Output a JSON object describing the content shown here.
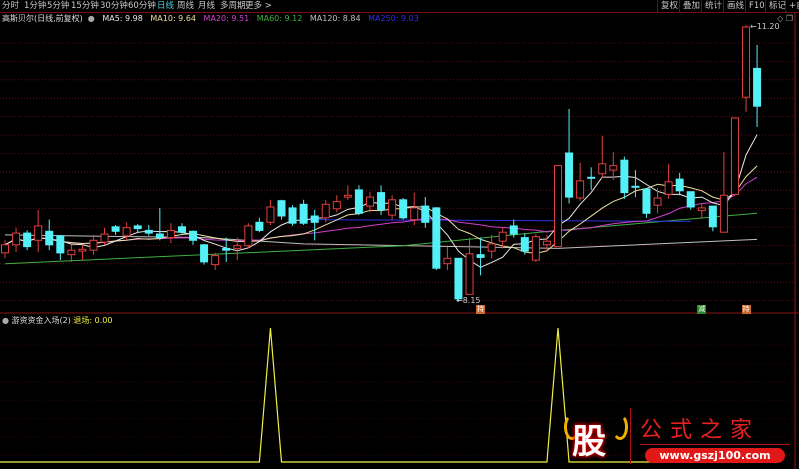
{
  "toolbar": {
    "tabs": [
      "分时",
      "1分钟",
      "5分钟",
      "15分钟",
      "30分钟",
      "60分钟",
      "日线",
      "周线",
      "月线",
      "多周期",
      "更多 >"
    ],
    "active_tab": "日线",
    "right_buttons": [
      "复权",
      "叠加",
      "统计",
      "画线",
      "F10",
      "标记",
      "+自"
    ]
  },
  "info": {
    "title": "高斯贝尔(日线,前复权)",
    "ma5": "MA5: 9.98",
    "ma10": "MA10: 9.64",
    "ma20": "MA20: 9.51",
    "ma60": "MA60: 9.12",
    "ma120": "MA120: 8.84",
    "ma250": "MA250: 9.03"
  },
  "corner_icons": {
    "diamond": "◇",
    "window": "❐"
  },
  "colors": {
    "up": "#e04040",
    "down": "#54f0f8",
    "ma5": "#e8e8e8",
    "ma10": "#e8e0a0",
    "ma20": "#d040d0",
    "ma60": "#40b040",
    "ma120": "#c0c0c0",
    "ma250": "#3030e0",
    "indicator": "#f0f040",
    "grid": "#7a1010"
  },
  "annotations": {
    "high": "11.20",
    "low": "8.15"
  },
  "markers": [
    {
      "text": "持",
      "color": "#c86a30",
      "index": 43
    },
    {
      "text": "减",
      "color": "#2a8a2a",
      "index": 63
    },
    {
      "text": "持",
      "color": "#c86a30",
      "index": 67
    }
  ],
  "indicator": {
    "name": "游资资金入场(2)",
    "value": "退场: 0.00"
  },
  "watermark": {
    "logo": "股",
    "title": "公式之家",
    "url": "www.gszj100.com"
  },
  "chart_data": {
    "type": "candlestick",
    "ylim": [
      8.0,
      11.5
    ],
    "candles_ohlc": [
      [
        8.69,
        8.78,
        8.83,
        8.63
      ],
      [
        8.78,
        8.91,
        8.97,
        8.7
      ],
      [
        8.91,
        8.76,
        8.94,
        8.72
      ],
      [
        8.83,
        8.99,
        9.17,
        8.7
      ],
      [
        8.93,
        8.78,
        9.06,
        8.72
      ],
      [
        8.88,
        8.69,
        8.89,
        8.61
      ],
      [
        8.67,
        8.72,
        8.78,
        8.59
      ],
      [
        8.71,
        8.73,
        8.78,
        8.61
      ],
      [
        8.72,
        8.83,
        8.89,
        8.67
      ],
      [
        8.81,
        8.9,
        8.97,
        8.78
      ],
      [
        8.98,
        8.93,
        9.0,
        8.89
      ],
      [
        8.88,
        8.97,
        9.03,
        8.83
      ],
      [
        8.99,
        8.96,
        9.01,
        8.92
      ],
      [
        8.94,
        8.91,
        9.0,
        8.88
      ],
      [
        8.9,
        8.86,
        9.19,
        8.83
      ],
      [
        8.86,
        8.94,
        9.02,
        8.8
      ],
      [
        8.98,
        8.92,
        9.02,
        8.89
      ],
      [
        8.93,
        8.83,
        8.94,
        8.78
      ],
      [
        8.78,
        8.59,
        8.79,
        8.56
      ],
      [
        8.56,
        8.66,
        8.69,
        8.5
      ],
      [
        8.74,
        8.72,
        8.86,
        8.59
      ],
      [
        8.74,
        8.77,
        8.86,
        8.61
      ],
      [
        8.77,
        8.99,
        9.02,
        8.74
      ],
      [
        9.03,
        8.94,
        9.08,
        8.92
      ],
      [
        9.03,
        9.2,
        9.28,
        9.0
      ],
      [
        9.27,
        9.1,
        9.28,
        9.06
      ],
      [
        9.19,
        9.02,
        9.22,
        8.99
      ],
      [
        9.23,
        9.02,
        9.28,
        9.0
      ],
      [
        9.1,
        9.03,
        9.17,
        8.83
      ],
      [
        9.08,
        9.23,
        9.28,
        9.03
      ],
      [
        9.18,
        9.26,
        9.33,
        9.14
      ],
      [
        9.31,
        9.33,
        9.44,
        9.28
      ],
      [
        9.39,
        9.13,
        9.44,
        9.11
      ],
      [
        9.21,
        9.31,
        9.37,
        9.14
      ],
      [
        9.36,
        9.17,
        9.44,
        9.11
      ],
      [
        9.11,
        9.28,
        9.33,
        9.06
      ],
      [
        9.28,
        9.08,
        9.3,
        9.06
      ],
      [
        9.06,
        9.19,
        9.36,
        9.0
      ],
      [
        9.21,
        9.03,
        9.31,
        8.97
      ],
      [
        9.19,
        8.52,
        9.2,
        8.5
      ],
      [
        8.57,
        8.63,
        8.76,
        8.5
      ],
      [
        8.63,
        8.18,
        8.63,
        8.15
      ],
      [
        8.23,
        8.68,
        8.86,
        8.23
      ],
      [
        8.67,
        8.64,
        8.86,
        8.44
      ],
      [
        8.71,
        8.79,
        8.89,
        8.63
      ],
      [
        8.82,
        8.92,
        8.97,
        8.74
      ],
      [
        8.99,
        8.9,
        9.06,
        8.86
      ],
      [
        8.86,
        8.71,
        8.91,
        8.67
      ],
      [
        8.61,
        8.87,
        8.9,
        8.59
      ],
      [
        8.78,
        8.82,
        8.89,
        8.7
      ],
      [
        8.76,
        9.66,
        9.66,
        8.76
      ],
      [
        9.8,
        9.31,
        10.29,
        9.24
      ],
      [
        9.3,
        9.49,
        9.69,
        9.27
      ],
      [
        9.53,
        9.52,
        9.64,
        9.39
      ],
      [
        9.57,
        9.68,
        9.99,
        9.52
      ],
      [
        9.61,
        9.66,
        9.81,
        9.5
      ],
      [
        9.72,
        9.36,
        9.76,
        9.29
      ],
      [
        9.43,
        9.42,
        9.61,
        9.31
      ],
      [
        9.4,
        9.13,
        9.4,
        9.08
      ],
      [
        9.22,
        9.3,
        9.41,
        9.13
      ],
      [
        9.34,
        9.48,
        9.68,
        9.29
      ],
      [
        9.51,
        9.38,
        9.58,
        9.33
      ],
      [
        9.37,
        9.2,
        9.37,
        9.17
      ],
      [
        9.16,
        9.19,
        9.24,
        9.08
      ],
      [
        9.21,
        8.98,
        9.21,
        8.93
      ],
      [
        8.92,
        9.33,
        9.81,
        8.92
      ],
      [
        9.34,
        10.19,
        10.19,
        9.34
      ],
      [
        10.42,
        11.2,
        11.22,
        10.26
      ],
      [
        10.74,
        10.32,
        11.0,
        10.09
      ]
    ],
    "ma60_points": [
      [
        0,
        8.57
      ],
      [
        36,
        8.77
      ],
      [
        50,
        8.94
      ],
      [
        68,
        9.13
      ]
    ],
    "ma120_points": [
      [
        0,
        8.89
      ],
      [
        18,
        8.86
      ],
      [
        27,
        8.79
      ],
      [
        50,
        8.74
      ],
      [
        68,
        8.84
      ]
    ],
    "ma250_points": [
      [
        27,
        9.06
      ],
      [
        62,
        9.04
      ]
    ],
    "indicator_signal": {
      "ylim": [
        0,
        1
      ],
      "spikes_at_index": [
        24,
        50
      ]
    }
  }
}
